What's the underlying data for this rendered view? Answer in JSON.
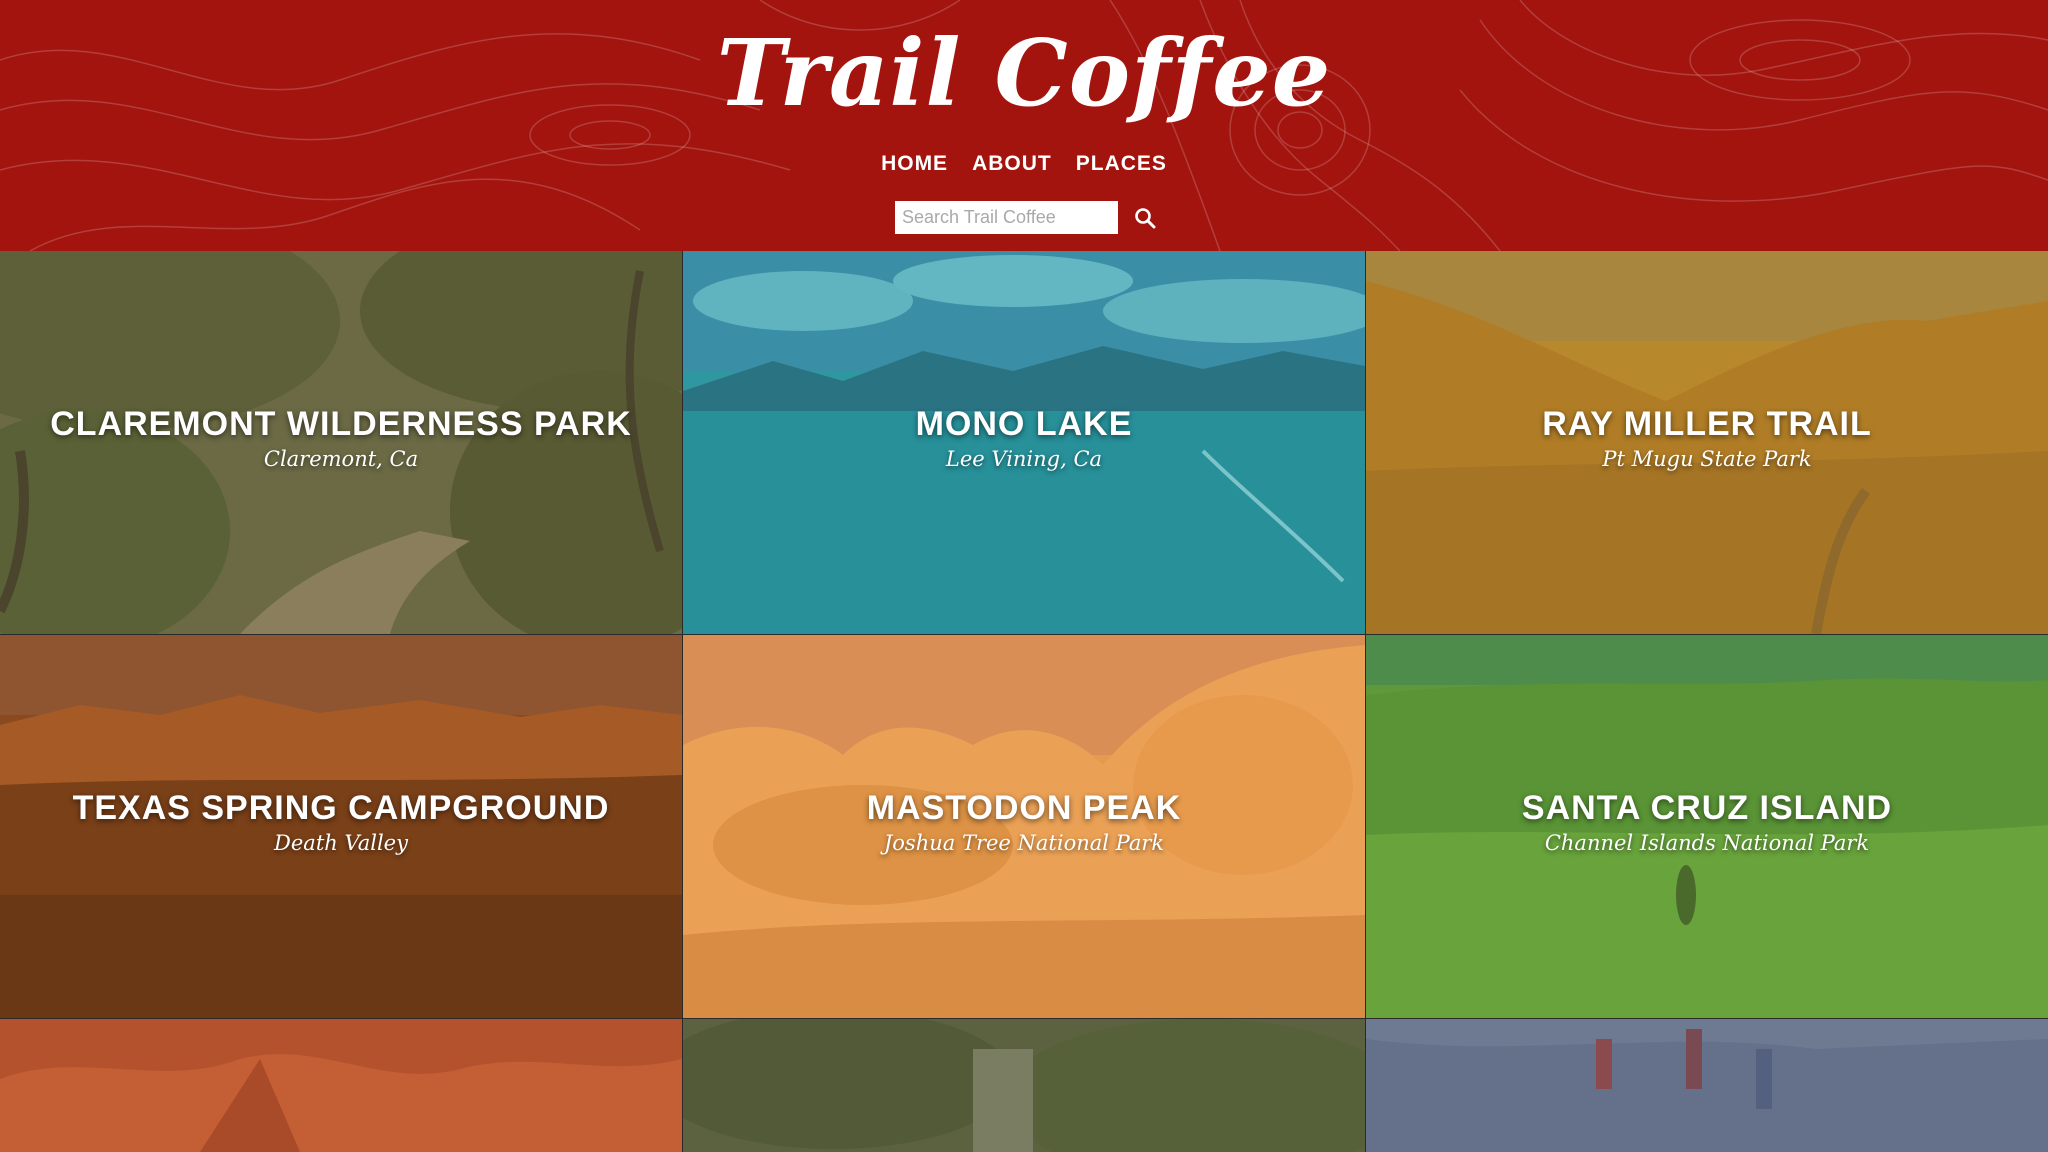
{
  "site": {
    "logo": "Trail Coffee",
    "brand_color": "#a3140f"
  },
  "nav": {
    "items": [
      {
        "label": "HOME"
      },
      {
        "label": "ABOUT"
      },
      {
        "label": "PLACES"
      }
    ]
  },
  "search": {
    "placeholder": "Search Trail Coffee",
    "value": "",
    "icon": "search-icon"
  },
  "places": [
    {
      "title": "CLAREMONT WILDERNESS PARK",
      "subtitle": "Claremont, Ca",
      "tint": "#6b6a45"
    },
    {
      "title": "MONO LAKE",
      "subtitle": "Lee Vining, Ca",
      "tint": "#2f97a0"
    },
    {
      "title": "RAY MILLER TRAIL",
      "subtitle": "Pt Mugu State Park",
      "tint": "#b8882c"
    },
    {
      "title": "TEXAS SPRING CAMPGROUND",
      "subtitle": "Death Valley",
      "tint": "#8a4a1f"
    },
    {
      "title": "MASTODON PEAK",
      "subtitle": "Joshua Tree National Park",
      "tint": "#e59a4e"
    },
    {
      "title": "SANTA CRUZ ISLAND",
      "subtitle": "Channel Islands National Park",
      "tint": "#5f9a3a"
    },
    {
      "title": "",
      "subtitle": "",
      "tint": "#b3522c"
    },
    {
      "title": "",
      "subtitle": "",
      "tint": "#5c6240"
    },
    {
      "title": "",
      "subtitle": "",
      "tint": "#6d7a92"
    }
  ]
}
